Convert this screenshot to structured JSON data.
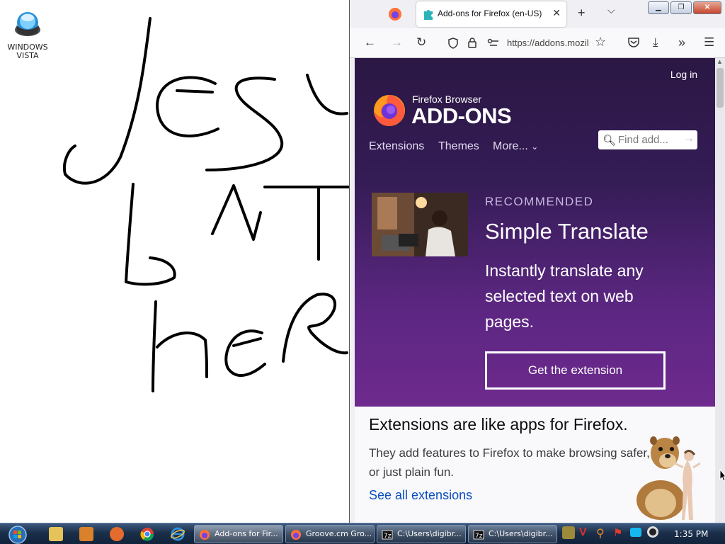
{
  "desktop": {
    "icon_label_line1": "WINDOWS",
    "icon_label_line2": "VISTA"
  },
  "browser": {
    "active_tab_title": "Add-ons for Firefox (en-US)",
    "url_display": "https://addons.mozilla.org",
    "page": {
      "login_label": "Log in",
      "brand_small": "Firefox Browser",
      "brand_large": "ADD-ONS",
      "nav": {
        "extensions": "Extensions",
        "themes": "Themes",
        "more": "More..."
      },
      "search_placeholder": "Find add...",
      "recommended": {
        "kicker": "RECOMMENDED",
        "name": "Simple Translate",
        "description": "Instantly translate any selected text on web pages.",
        "button": "Get the extension"
      },
      "extensions_section": {
        "heading": "Extensions are like apps for Firefox.",
        "body": "They add features to Firefox to make browsing safer, or just plain fun.",
        "link": "See all extensions"
      }
    }
  },
  "taskbar": {
    "tasks": [
      {
        "label": "Add-ons for Fir...",
        "icon": "firefox-icon",
        "active": true
      },
      {
        "label": "Groove.cm Gro...",
        "icon": "firefox-icon",
        "active": false
      },
      {
        "label": "C:\\Users\\digibr...",
        "icon": "7zip-icon",
        "active": false
      },
      {
        "label": "C:\\Users\\digibr...",
        "icon": "7zip-icon",
        "active": false
      }
    ],
    "clock": "1:35 PM"
  },
  "colors": {
    "hero_top": "#2b1744",
    "hero_bottom": "#6e2a8e",
    "link": "#0a4ec0"
  }
}
